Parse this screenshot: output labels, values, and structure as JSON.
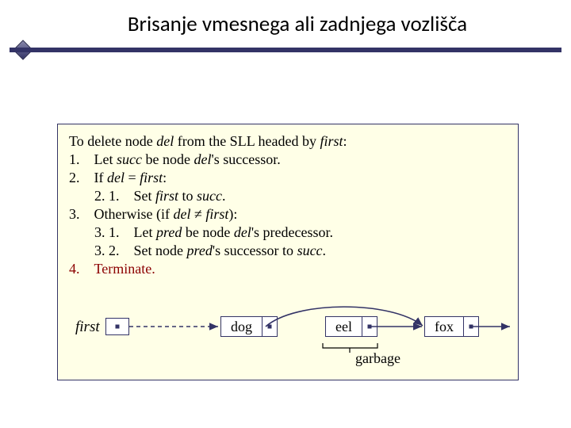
{
  "title": "Brisanje vmesnega ali zadnjega vozlišča",
  "algo": {
    "intro_prefix": "To delete node ",
    "intro_del": "del",
    "intro_mid": " from the SLL headed by ",
    "intro_first": "first",
    "intro_end": ":",
    "s1_prefix": "1. Let ",
    "s1_succ": "succ",
    "s1_mid": " be node ",
    "s1_del": "del",
    "s1_end": "'s successor.",
    "s2_prefix": "2. If ",
    "s2_del": "del",
    "s2_eq": " = ",
    "s2_first": "first",
    "s2_end": ":",
    "s21_prefix": "2. 1. Set ",
    "s21_first": "first",
    "s21_to": " to ",
    "s21_succ": "succ",
    "s21_end": ".",
    "s3_prefix": "3. Otherwise (if ",
    "s3_del": "del",
    "s3_neq": " ≠ ",
    "s3_first": "first",
    "s3_end": "):",
    "s31_prefix": "3. 1. Let ",
    "s31_pred": "pred",
    "s31_mid": " be node ",
    "s31_del": "del",
    "s31_end": "'s predecessor.",
    "s32_prefix": "3. 2. Set node ",
    "s32_pred": "pred",
    "s32_mid": "'s successor to ",
    "s32_succ": "succ",
    "s32_end": ".",
    "s4": "4. Terminate."
  },
  "diagram": {
    "first_label": "first",
    "node1": "dog",
    "node2": "eel",
    "node3": "fox",
    "garbage": "garbage"
  }
}
